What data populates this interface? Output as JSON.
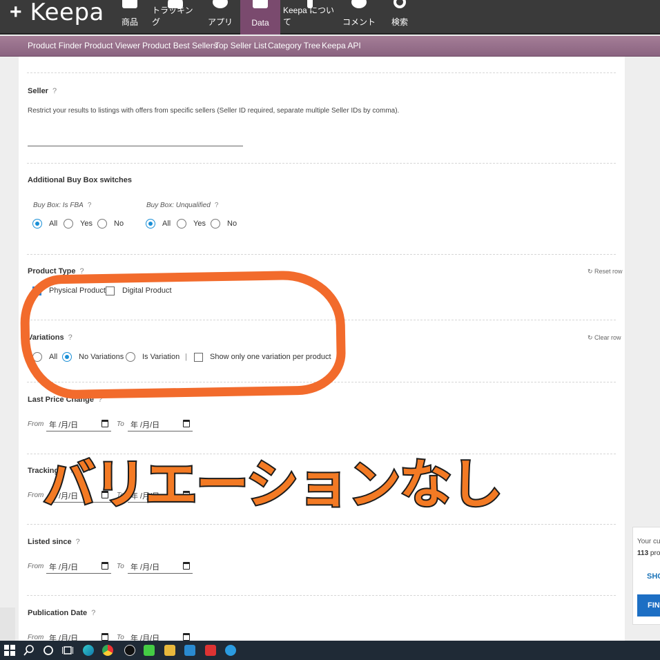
{
  "topnav": {
    "logo_symbol": "+",
    "brand": "Keepa",
    "items": [
      {
        "label": "商品",
        "icon": "product-icon"
      },
      {
        "label": "トラッキング",
        "icon": "bell-icon"
      },
      {
        "label": "アプリ",
        "icon": "download-icon"
      },
      {
        "label": "Data",
        "icon": "data-cube-icon",
        "active": true
      },
      {
        "label": "Keepa について",
        "icon": "info-icon"
      },
      {
        "label": "コメント",
        "icon": "comment-icon"
      },
      {
        "label": "検索",
        "icon": "search-icon"
      }
    ]
  },
  "subnav": {
    "items": [
      "Product Finder",
      "Product Viewer",
      "Product Best Sellers",
      "Top Seller List",
      "Category Tree",
      "Keepa API"
    ]
  },
  "seller": {
    "title": "Seller",
    "help": "?",
    "description": "Restrict your results to listings with offers from specific sellers (Seller ID required, separate multiple Seller IDs by comma)."
  },
  "buybox": {
    "title": "Additional Buy Box switches",
    "fba": {
      "label": "Buy Box: Is FBA",
      "help": "?",
      "options": [
        "All",
        "Yes",
        "No"
      ],
      "selected": "All"
    },
    "unqualified": {
      "label": "Buy Box: Unqualified",
      "help": "?",
      "options": [
        "All",
        "Yes",
        "No"
      ],
      "selected": "All"
    }
  },
  "product_type": {
    "title": "Product Type",
    "help": "?",
    "reset": "Reset row",
    "options": [
      {
        "label": "Physical Product",
        "checked": true
      },
      {
        "label": "Digital Product",
        "checked": false
      }
    ]
  },
  "variations": {
    "title": "Variations",
    "help": "?",
    "reset": "Clear row",
    "options": [
      "All",
      "No Variations",
      "Is Variation"
    ],
    "selected": "No Variations",
    "divider": "|",
    "one_variation": "Show only one variation per product"
  },
  "dates": {
    "from": "From",
    "to": "To",
    "placeholder": "年 /月/日",
    "last_price_change": {
      "title": "Last Price Change",
      "help": "?"
    },
    "tracking_since": {
      "title": "Tracking s",
      "help": "?"
    },
    "listed_since": {
      "title": "Listed since",
      "help": "?"
    },
    "publication_date": {
      "title": "Publication Date",
      "help": "?"
    }
  },
  "annotation": {
    "text": "バリエーションなし",
    "color": "#f37a24"
  },
  "right_panel": {
    "line1": "Your cu",
    "count": "113",
    "count_suffix": "pro",
    "show": "SHO",
    "find": "FIN"
  },
  "colors": {
    "accent": "#1a8fd6",
    "nav_active": "#7a4a6e",
    "subnav": "#8a6380",
    "annotation": "#f26b2c"
  }
}
